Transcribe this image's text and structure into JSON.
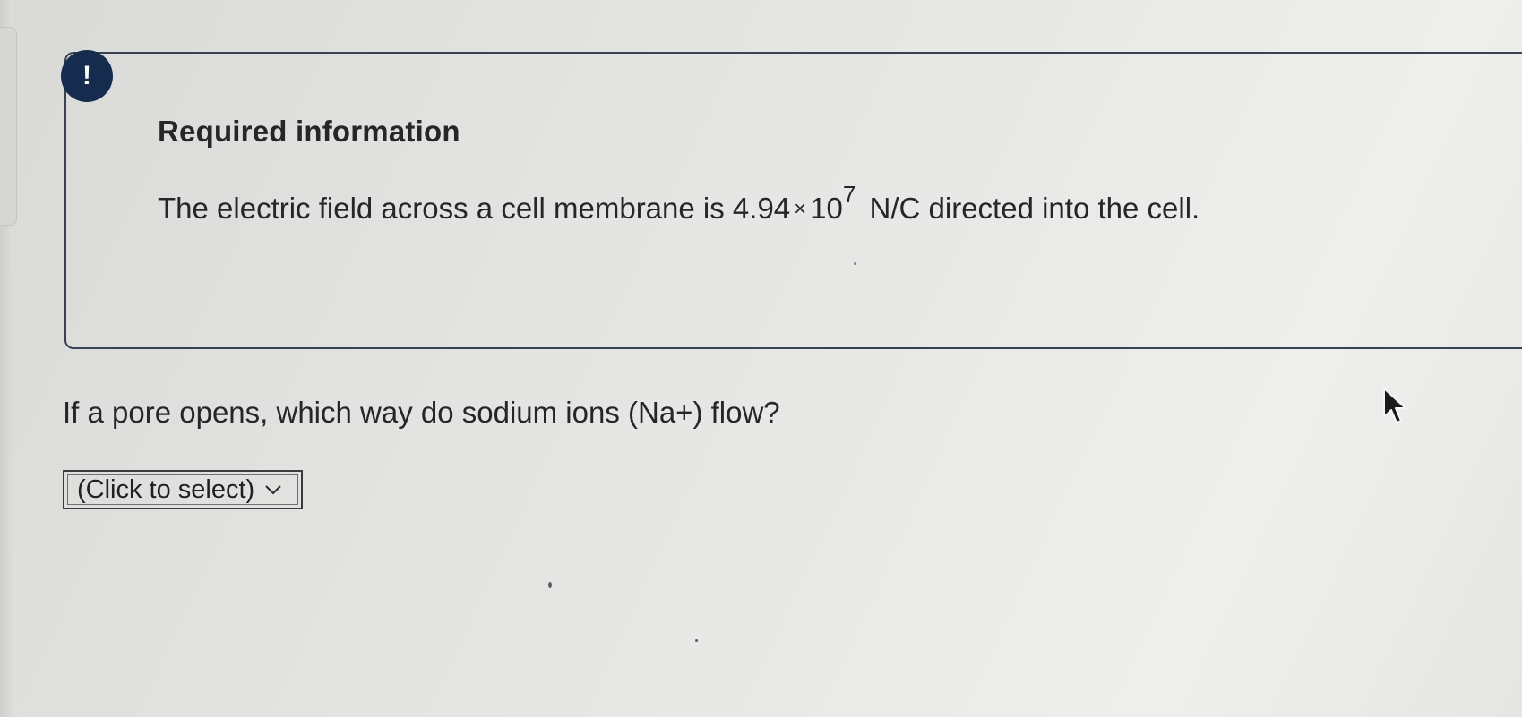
{
  "info_panel": {
    "badge_symbol": "!",
    "title": "Required information",
    "statement": {
      "before": "The electric field across a cell membrane is",
      "mantissa": "4.94",
      "times": "×",
      "base": "10",
      "exponent": "7",
      "after": "N/C directed into the cell."
    }
  },
  "question": {
    "text": "If a pore opens, which way do sodium ions (Na+) flow?"
  },
  "answer_select": {
    "value": "(Click to select)",
    "icon": "chevron-down-icon"
  },
  "colors": {
    "badge": "#152c4e",
    "panel_border": "#3a4150",
    "text": "#262626"
  },
  "cursor_icon": "mouse-pointer-icon"
}
